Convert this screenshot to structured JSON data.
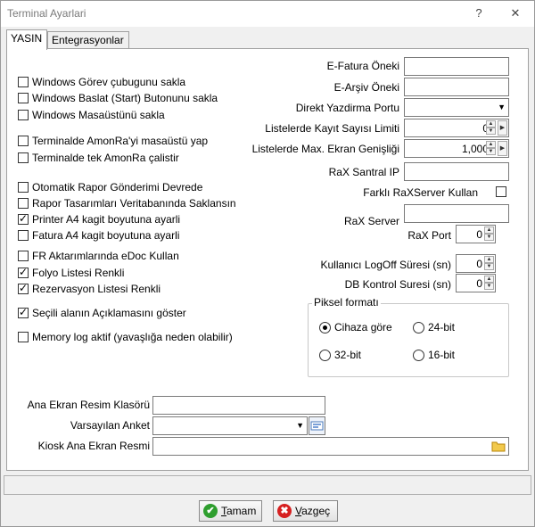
{
  "window": {
    "title": "Terminal Ayarlari",
    "help_label": "?",
    "close_label": "✕"
  },
  "tabs": [
    {
      "label": "YASIN",
      "active": true
    },
    {
      "label": "Entegrasyonlar",
      "active": false
    }
  ],
  "left_options": [
    {
      "label": "Windows Görev çubugunu sakla",
      "checked": false
    },
    {
      "label": "Windows Baslat (Start) Butonunu sakla",
      "checked": false
    },
    {
      "label": "Windows Masaüstünü sakla",
      "checked": false
    },
    {
      "label": "Terminalde AmonRa'yi masaüstü yap",
      "checked": false
    },
    {
      "label": "Terminalde tek AmonRa çalistir",
      "checked": false
    },
    {
      "label": "Otomatik Rapor Gönderimi Devrede",
      "checked": false
    },
    {
      "label": "Rapor Tasarımları Veritabanında Saklansın",
      "checked": false
    },
    {
      "label": "Printer A4 kagit boyutuna ayarli",
      "checked": true
    },
    {
      "label": "Fatura A4 kagit boyutuna ayarli",
      "checked": false
    },
    {
      "label": "FR Aktarımlarında eDoc Kullan",
      "checked": false
    },
    {
      "label": "Folyo Listesi Renkli",
      "checked": true
    },
    {
      "label": "Rezervasyon Listesi Renkli",
      "checked": true
    },
    {
      "label": "Seçili alanın Açıklamasını göster",
      "checked": true
    },
    {
      "label": "Memory log aktif (yavaşlığa neden olabilir)",
      "checked": false
    }
  ],
  "right_fields": {
    "efatura_label": "E-Fatura Öneki",
    "efatura_value": "",
    "earsiv_label": "E-Arşiv Öneki",
    "earsiv_value": "",
    "printer_label": "Direkt Yazdirma Portu",
    "printer_value": "",
    "kayit_label": "Listelerde Kayıt Sayısı Limiti",
    "kayit_value": "0",
    "genislik_label": "Listelerde Max. Ekran Genişliği",
    "genislik_value": "1,000",
    "santral_label": "RaX Santral IP",
    "santral_value": "",
    "farkli_label": "Farklı RaXServer Kullan",
    "farkli_checked": false,
    "server_label": "RaX Server",
    "server_value": "",
    "port_label": "RaX Port",
    "port_value": "0",
    "logoff_label": "Kullanıcı LogOff Süresi (sn)",
    "logoff_value": "0",
    "db_label": "DB Kontrol Suresi (sn)",
    "db_value": "0"
  },
  "piksel": {
    "legend": "Piksel formatı",
    "options": [
      {
        "label": "Cihaza göre",
        "selected": true
      },
      {
        "label": "24-bit",
        "selected": false
      },
      {
        "label": "32-bit",
        "selected": false
      },
      {
        "label": "16-bit",
        "selected": false
      }
    ]
  },
  "bottom_fields": {
    "resim_label": "Ana Ekran Resim Klasörü",
    "resim_value": "",
    "anket_label": "Varsayılan Anket",
    "anket_value": "",
    "kiosk_label": "Kiosk Ana Ekran Resmi",
    "kiosk_value": ""
  },
  "status_text": "",
  "buttons": {
    "ok_rest": "amam",
    "ok_accel": "T",
    "cancel_rest": "azgeç",
    "cancel_accel": "V"
  },
  "colors": {
    "ok_icon": "#2e9e2e",
    "cancel_icon": "#d62020"
  }
}
